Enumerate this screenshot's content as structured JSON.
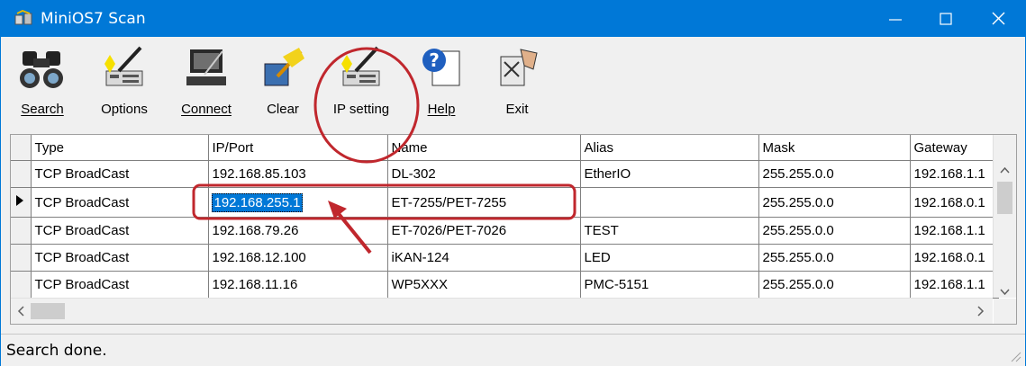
{
  "window": {
    "title": "MiniOS7 Scan"
  },
  "toolbar": {
    "buttons": [
      {
        "label": "Search",
        "icon": "binoculars-icon",
        "mnemonic": "S"
      },
      {
        "label": "Options",
        "icon": "options-icon",
        "mnemonic": "O"
      },
      {
        "label": "Connect",
        "icon": "connect-icon",
        "mnemonic": "C"
      },
      {
        "label": "Clear",
        "icon": "broom-icon",
        "mnemonic": "r"
      },
      {
        "label": "IP setting",
        "icon": "ip-setting-icon",
        "mnemonic": "I"
      },
      {
        "label": "Help",
        "icon": "help-icon",
        "mnemonic": "H"
      },
      {
        "label": "Exit",
        "icon": "exit-icon",
        "mnemonic": "x"
      }
    ]
  },
  "grid": {
    "columns": [
      "Type",
      "IP/Port",
      "Name",
      "Alias",
      "Mask",
      "Gateway"
    ],
    "rows": [
      [
        "TCP BroadCast",
        "192.168.85.103",
        "DL-302",
        "EtherIO",
        "255.255.0.0",
        "192.168.1.1"
      ],
      [
        "TCP BroadCast",
        "192.168.255.1",
        "ET-7255/PET-7255",
        "",
        "255.255.0.0",
        "192.168.0.1"
      ],
      [
        "TCP BroadCast",
        "192.168.79.26",
        "ET-7026/PET-7026",
        "TEST",
        "255.255.0.0",
        "192.168.1.1"
      ],
      [
        "TCP BroadCast",
        "192.168.12.100",
        "iKAN-124",
        "LED",
        "255.255.0.0",
        "192.168.0.1"
      ],
      [
        "TCP BroadCast",
        "192.168.11.16",
        "WP5XXX",
        "PMC-5151",
        "255.255.0.0",
        "192.168.1.1"
      ]
    ],
    "selected_row": 1
  },
  "status": {
    "text": "Search done."
  },
  "colors": {
    "titlebar": "#0078d7",
    "selection": "#0078d7",
    "annotation": "#c0272d"
  }
}
